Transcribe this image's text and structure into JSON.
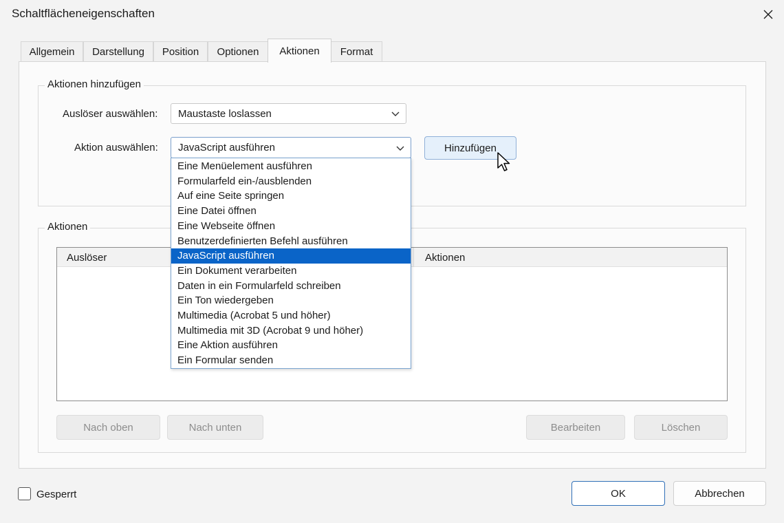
{
  "window": {
    "title": "Schaltflächeneigenschaften"
  },
  "tabs": [
    {
      "label": "Allgemein"
    },
    {
      "label": "Darstellung"
    },
    {
      "label": "Position"
    },
    {
      "label": "Optionen"
    },
    {
      "label": "Aktionen",
      "active": true
    },
    {
      "label": "Format"
    }
  ],
  "add_actions": {
    "legend": "Aktionen hinzufügen",
    "trigger_label": "Auslöser auswählen:",
    "trigger_value": "Maustaste loslassen",
    "action_label": "Aktion auswählen:",
    "action_value": "JavaScript ausführen",
    "add_button": "Hinzufügen"
  },
  "action_dropdown": {
    "selected_index": 6,
    "options": [
      "Eine Menüelement ausführen",
      "Formularfeld ein-/ausblenden",
      "Auf eine Seite springen",
      "Eine Datei öffnen",
      "Eine Webseite öffnen",
      "Benutzerdefinierten Befehl ausführen",
      "JavaScript ausführen",
      "Ein Dokument verarbeiten",
      "Daten in ein Formularfeld schreiben",
      "Ein Ton wiedergeben",
      "Multimedia (Acrobat 5 und höher)",
      "Multimedia mit 3D (Acrobat 9 und höher)",
      "Eine Aktion ausführen",
      "Ein Formular senden"
    ]
  },
  "actions": {
    "legend": "Aktionen",
    "columns": [
      "Auslöser",
      "Aktionen"
    ],
    "buttons": {
      "up": "Nach oben",
      "down": "Nach unten",
      "edit": "Bearbeiten",
      "delete": "Löschen"
    }
  },
  "footer": {
    "locked_label": "Gesperrt",
    "locked_checked": false,
    "ok": "OK",
    "cancel": "Abbrechen"
  },
  "colors": {
    "selection": "#0a64c8",
    "focus_border": "#2f6fb7"
  }
}
